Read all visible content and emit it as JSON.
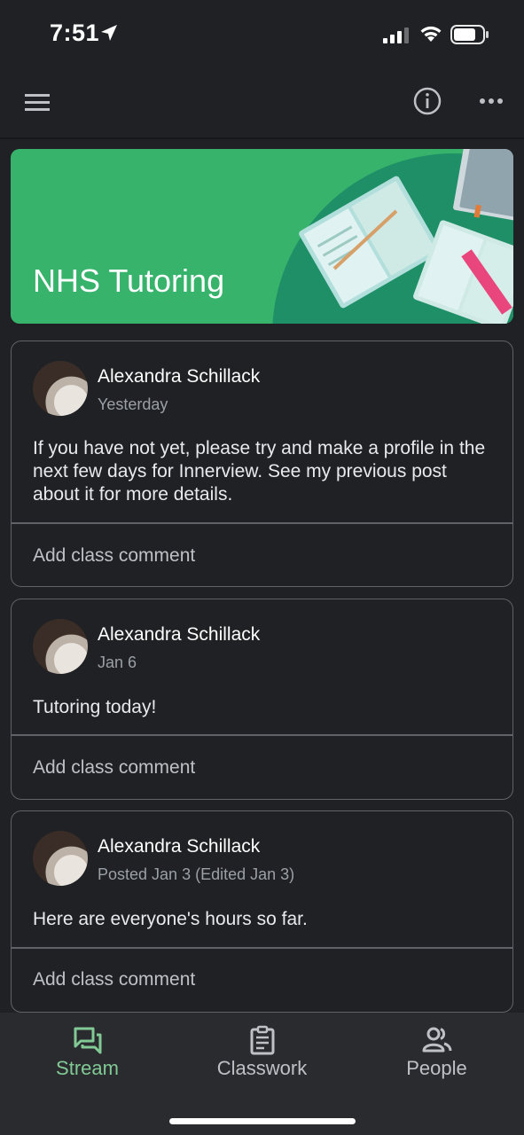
{
  "status_bar": {
    "time": "7:51"
  },
  "app_bar": {
    "menu_icon": "menu-icon",
    "info_icon": "info-icon",
    "more_icon": "more-horizontal-icon"
  },
  "banner": {
    "title": "NHS Tutoring",
    "color": "#37b36b"
  },
  "posts": [
    {
      "author": "Alexandra Schillack",
      "date": "Yesterday",
      "body": "If you have not yet, please try and make a profile in the next few days for Innerview. See my previous post about it for more details.",
      "comment_label": "Add class comment"
    },
    {
      "author": "Alexandra Schillack",
      "date": "Jan 6",
      "body": "Tutoring today!",
      "comment_label": "Add class comment"
    },
    {
      "author": "Alexandra Schillack",
      "date": "Posted Jan 3 (Edited Jan 3)",
      "body": "Here are everyone's hours so far.",
      "comment_label": "Add class comment"
    }
  ],
  "bottom_nav": {
    "items": [
      {
        "label": "Stream",
        "icon": "stream-icon",
        "active": true
      },
      {
        "label": "Classwork",
        "icon": "clipboard-icon",
        "active": false
      },
      {
        "label": "People",
        "icon": "people-icon",
        "active": false
      }
    ],
    "active_color": "#81c995"
  }
}
